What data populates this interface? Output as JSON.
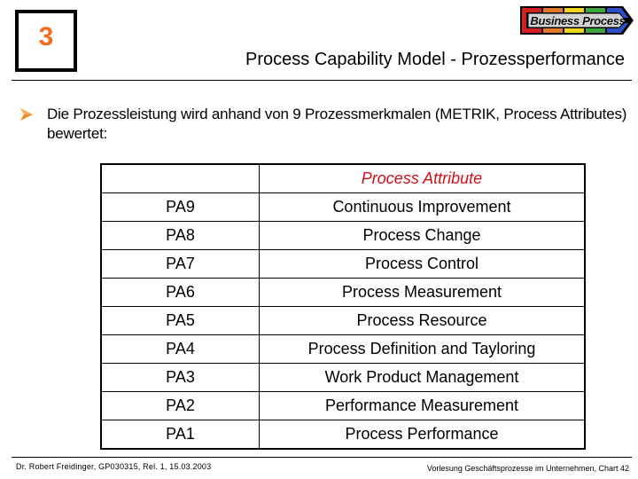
{
  "chapter": {
    "number": "3",
    "color": "#f26a1b"
  },
  "logo": {
    "text": "Business Process",
    "icon": "business-process-chevron-logo",
    "stripe_colors": [
      "#d21f1f",
      "#e07a2a",
      "#f0d61a",
      "#3aa83a",
      "#2a50c8"
    ]
  },
  "header": {
    "title": "Process Capability Model - Prozessperformance"
  },
  "body": {
    "bullet_icon": "arrow-bullet-icon",
    "bullet_color": "#f08a24",
    "bullet_text": "Die Prozessleistung wird anhand von 9 Prozessmerkmalen (METRIK, Process Attributes) bewertet:"
  },
  "table": {
    "header": {
      "id": "",
      "attribute": "Process Attribute"
    },
    "header_color": "#d3101a",
    "rows": [
      {
        "id": "PA9",
        "attribute": "Continuous Improvement"
      },
      {
        "id": "PA8",
        "attribute": "Process Change"
      },
      {
        "id": "PA7",
        "attribute": "Process Control"
      },
      {
        "id": "PA6",
        "attribute": "Process Measurement"
      },
      {
        "id": "PA5",
        "attribute": "Process Resource"
      },
      {
        "id": "PA4",
        "attribute": "Process Definition and Tayloring"
      },
      {
        "id": "PA3",
        "attribute": "Work Product Management"
      },
      {
        "id": "PA2",
        "attribute": "Performance Measurement"
      },
      {
        "id": "PA1",
        "attribute": "Process Performance"
      }
    ]
  },
  "footer": {
    "left": "Dr. Robert Freidinger, GP030315, Rel. 1, 15.03.2003",
    "right": "Vorlesung Geschäftsprozesse im Unternehmen, Chart 42"
  }
}
